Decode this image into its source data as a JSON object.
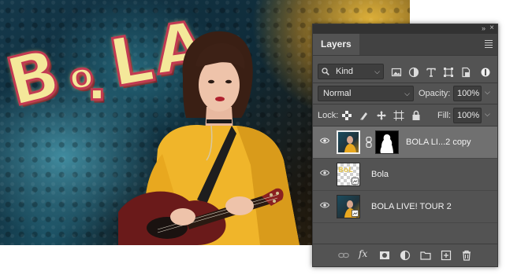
{
  "artwork": {
    "neon_text": "BOLA",
    "description_icon": "guitar-player-photo"
  },
  "panel": {
    "tab_label": "Layers",
    "filter": {
      "value": "Kind"
    },
    "blend_mode": {
      "value": "Normal"
    },
    "opacity": {
      "label": "Opacity:",
      "value": "100%"
    },
    "lock": {
      "label": "Lock:"
    },
    "fill": {
      "label": "Fill:",
      "value": "100%"
    },
    "layers": [
      {
        "name": "BOLA LI...2 copy",
        "selected": true,
        "has_mask": true
      },
      {
        "name": "Bola",
        "selected": false,
        "has_mask": false
      },
      {
        "name": "BOLA LIVE! TOUR 2",
        "selected": false,
        "has_mask": false
      }
    ],
    "bottom_icons": [
      "link-layers-icon",
      "fx-icon",
      "add-mask-icon",
      "adjustment-layer-icon",
      "group-folder-icon",
      "new-layer-icon",
      "trash-icon"
    ]
  },
  "colors": {
    "panel_bg": "#535353",
    "selected_row": "#707070",
    "field_bg": "#3e3e3e",
    "neon_fill": "#f4e89a",
    "neon_stroke": "#c23a52",
    "sweater": "#f0b52a"
  }
}
